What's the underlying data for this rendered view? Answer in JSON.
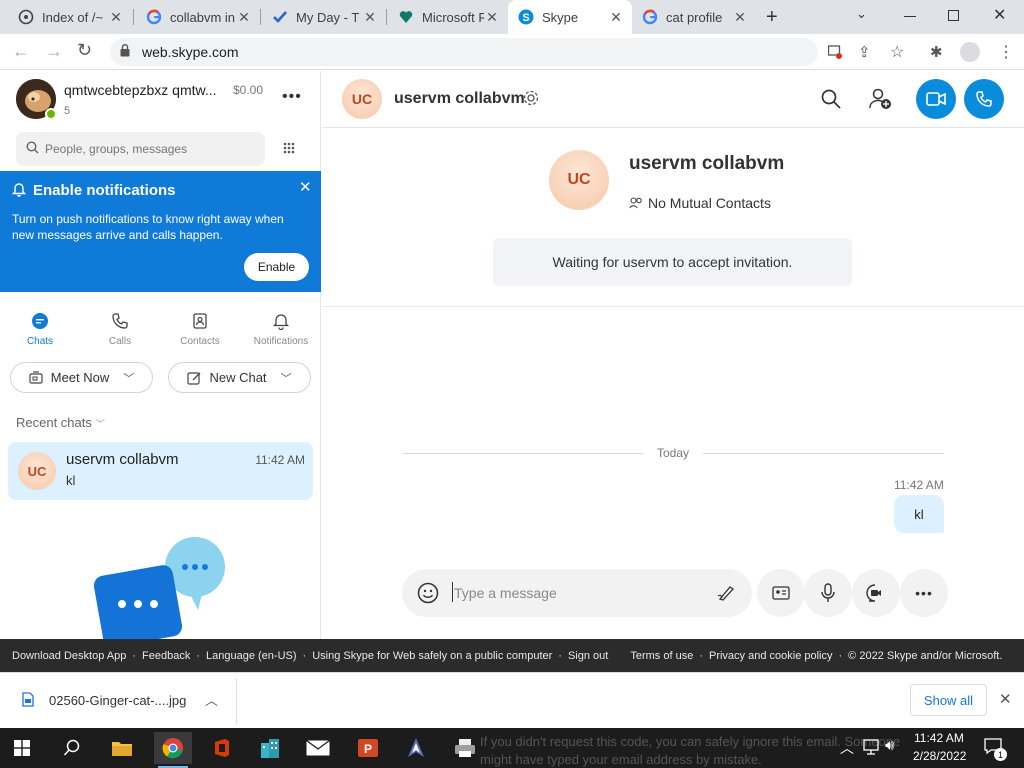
{
  "browser": {
    "tabs": [
      {
        "label": "Index of /~",
        "icon": "folder-icon",
        "active": false
      },
      {
        "label": "collabvm in",
        "icon": "google-icon",
        "active": false
      },
      {
        "label": "My Day - T",
        "icon": "check-icon",
        "active": false
      },
      {
        "label": "Microsoft R",
        "icon": "heart-shield-icon",
        "active": false
      },
      {
        "label": "Skype",
        "icon": "skype-icon",
        "active": true
      },
      {
        "label": "cat profile",
        "icon": "google-icon",
        "active": false
      }
    ],
    "url": "web.skype.com"
  },
  "profile": {
    "name": "qmtwcebtepzbxz qmtw...",
    "credit": "$0.00",
    "badge_count": "5"
  },
  "search": {
    "placeholder": "People, groups, messages"
  },
  "notification": {
    "title": "Enable notifications",
    "body": "Turn on push notifications to know right away when new messages arrive and calls happen.",
    "button": "Enable"
  },
  "nav": {
    "chats": "Chats",
    "calls": "Calls",
    "contacts": "Contacts",
    "notifications": "Notifications"
  },
  "actions": {
    "meet_now": "Meet Now",
    "new_chat": "New Chat"
  },
  "recent": {
    "header": "Recent chats",
    "items": [
      {
        "initials": "UC",
        "name": "uservm collabvm",
        "time": "11:42 AM",
        "preview": "kl"
      }
    ]
  },
  "conversation": {
    "initials": "UC",
    "name": "uservm collabvm",
    "mutual": "No Mutual Contacts",
    "waiting": "Waiting for uservm to accept invitation.",
    "day_divider": "Today",
    "messages": [
      {
        "time": "11:42 AM",
        "text": "kl"
      }
    ],
    "composer_placeholder": "Type a message"
  },
  "colors": {
    "skype_blue": "#0f7ad8",
    "call_button": "#0a8cdc",
    "bubble": "#dcf1fd"
  },
  "footer": {
    "links": [
      "Download Desktop App",
      "Feedback",
      "Language (en-US)",
      "Using Skype for Web safely on a public computer",
      "Sign out",
      "Terms of use",
      "Privacy and cookie policy",
      "© 2022 Skype and/or Microsoft."
    ]
  },
  "download": {
    "filename": "02560-Ginger-cat-....jpg",
    "show_all": "Show all"
  },
  "taskbar": {
    "time": "11:42 AM",
    "date": "2/28/2022",
    "notification_count": "1",
    "background_text_1": "If you didn't request this code, you can safely ignore this email. Someone",
    "background_text_2": "might have typed your email address by mistake."
  }
}
